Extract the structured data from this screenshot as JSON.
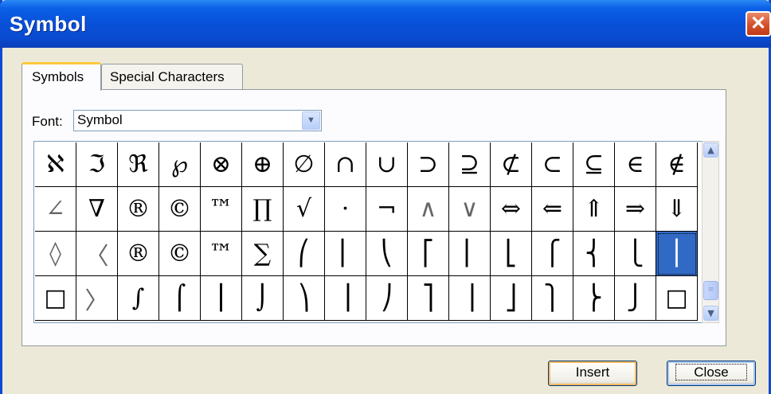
{
  "window": {
    "title": "Symbol",
    "close_glyph": "✕"
  },
  "tabs": [
    {
      "label": "Symbols",
      "active": true
    },
    {
      "label": "Special Characters",
      "active": false
    }
  ],
  "font": {
    "label": "Font:",
    "value": "Symbol"
  },
  "symbols": [
    [
      "ℵ",
      "ℑ",
      "ℜ",
      "℘",
      "⊗",
      "⊕",
      "∅",
      "∩",
      "∪",
      "⊃",
      "⊇",
      "⊄",
      "⊂",
      "⊆",
      "∈",
      "∉"
    ],
    [
      "∠",
      "∇",
      "®",
      "©",
      "™",
      "∏",
      "√",
      "·",
      "¬",
      "∧",
      "∨",
      "⇔",
      "⇐",
      "⇑",
      "⇒",
      "⇓"
    ],
    [
      "◊",
      "〈",
      "®",
      "©",
      "™",
      "∑",
      "⎛",
      "⎜",
      "⎝",
      "⎡",
      "⎢",
      "⎣",
      "⎧",
      "⎨",
      "⎩",
      "⎪"
    ],
    [
      "□",
      "〉",
      "∫",
      "⌠",
      "⎮",
      "⌡",
      "⎞",
      "⎟",
      "⎠",
      "⎤",
      "⎥",
      "⎦",
      "⎫",
      "⎬",
      "⎭",
      "□"
    ]
  ],
  "buttons": {
    "insert": "Insert",
    "close": "Close"
  },
  "scrollbar": {
    "up": "▲",
    "down": "▼",
    "thumb_grip": "≡"
  }
}
